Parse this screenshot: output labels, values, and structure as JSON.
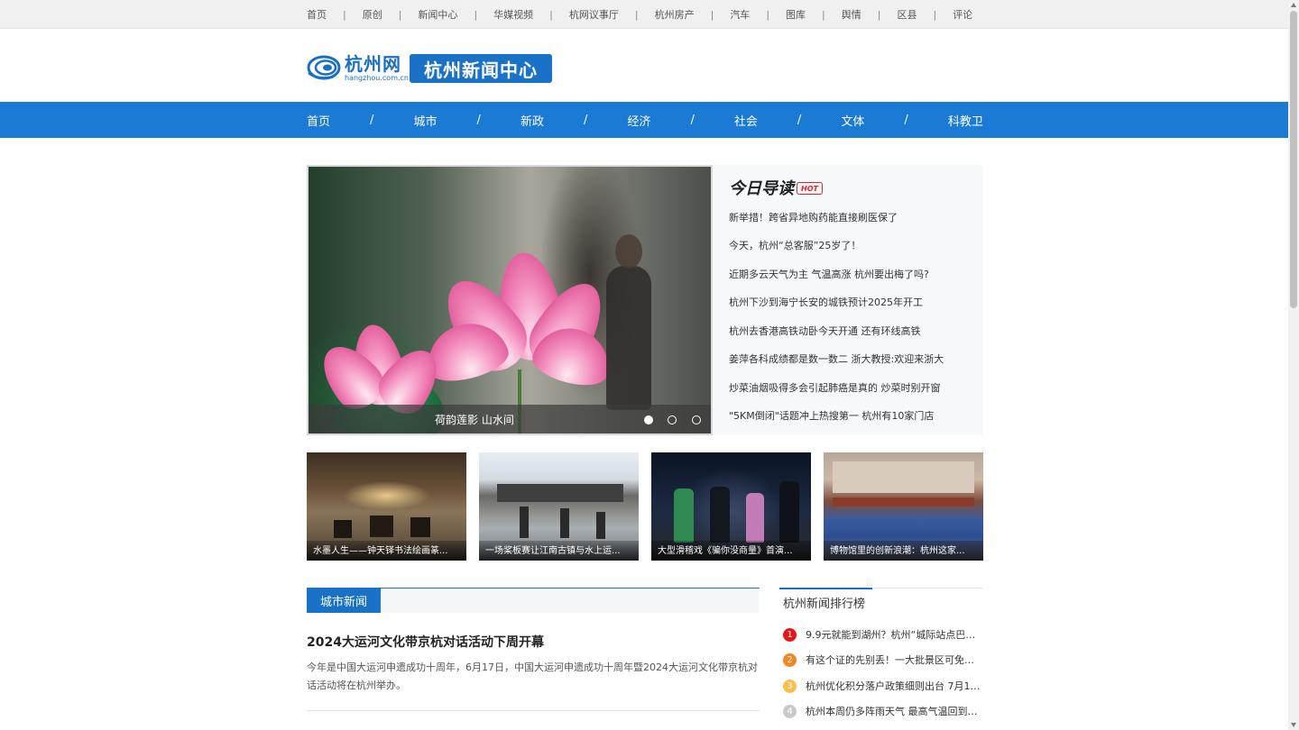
{
  "topbar": {
    "links": [
      "首页",
      "原创",
      "新闻中心",
      "华媒视频",
      "杭网议事厅",
      "杭州房产",
      "汽车",
      "图库",
      "舆情",
      "区县",
      "评论"
    ],
    "separator": "|"
  },
  "header": {
    "logo_cn": "杭州网",
    "logo_en": "hangzhou.com.cn",
    "channel_title": "杭州新闻中心"
  },
  "nav": {
    "items": [
      "首页",
      "城市",
      "新政",
      "经济",
      "社会",
      "文体",
      "科教卫"
    ],
    "separator": "/"
  },
  "carousel": {
    "caption": "荷韵莲影 山水间",
    "slide_count": 3,
    "active_slide": 1
  },
  "guide": {
    "title": "今日导读",
    "badge": "HOT",
    "items": [
      "新举措！跨省异地购药能直接刷医保了",
      "今天，杭州“总客服”25岁了！",
      "近期多云天气为主 气温高涨 杭州要出梅了吗?",
      "杭州下沙到海宁长安的城铁预计2025年开工",
      "杭州去香港高铁动卧今天开通 还有环线高铁",
      "姜萍各科成绩都是数一数二 浙大教授:欢迎来浙大",
      "炒菜油烟吸得多会引起肺癌是真的 炒菜时别开窗",
      "\"5KM倒闭\"话题冲上热搜第一 杭州有10家门店"
    ]
  },
  "thumbnails": [
    "水墨人生——钟天铎书法绘画篆...",
    "一场桨板赛让江南古镇与水上运...",
    "大型滑稽戏《骗你没商量》首演...",
    "博物馆里的创新浪潮：杭州这家..."
  ],
  "city_news": {
    "tab": "城市新闻",
    "article_title": "2024大运河文化带京杭对话活动下周开幕",
    "article_summary": "今年是中国大运河申遗成功十周年，6月17日，中国大运河申遗成功十周年暨2024大运河文化带京杭对话活动将在杭州举办。"
  },
  "ranking": {
    "title": "杭州新闻排行榜",
    "items": [
      {
        "rank": "1",
        "text": "9.9元就能到湖州？杭州“城际站点巴士..."
      },
      {
        "rank": "2",
        "text": "有这个证的先别丢！一大批景区可免费..."
      },
      {
        "rank": "3",
        "text": "杭州优化积分落户政策细则出台 7月1日..."
      },
      {
        "rank": "4",
        "text": "杭州本周仍多阵雨天气 最高气温回到30..."
      }
    ],
    "colors": {
      "rank1": "#e8161b",
      "rank2": "#f5851f",
      "rank3": "#f8c04a",
      "rank4": "#c9c9c9"
    }
  },
  "colors": {
    "nav_blue": "#1a7ad4",
    "brand_blue": "#1a72c8",
    "hot_red": "#e0222e"
  }
}
